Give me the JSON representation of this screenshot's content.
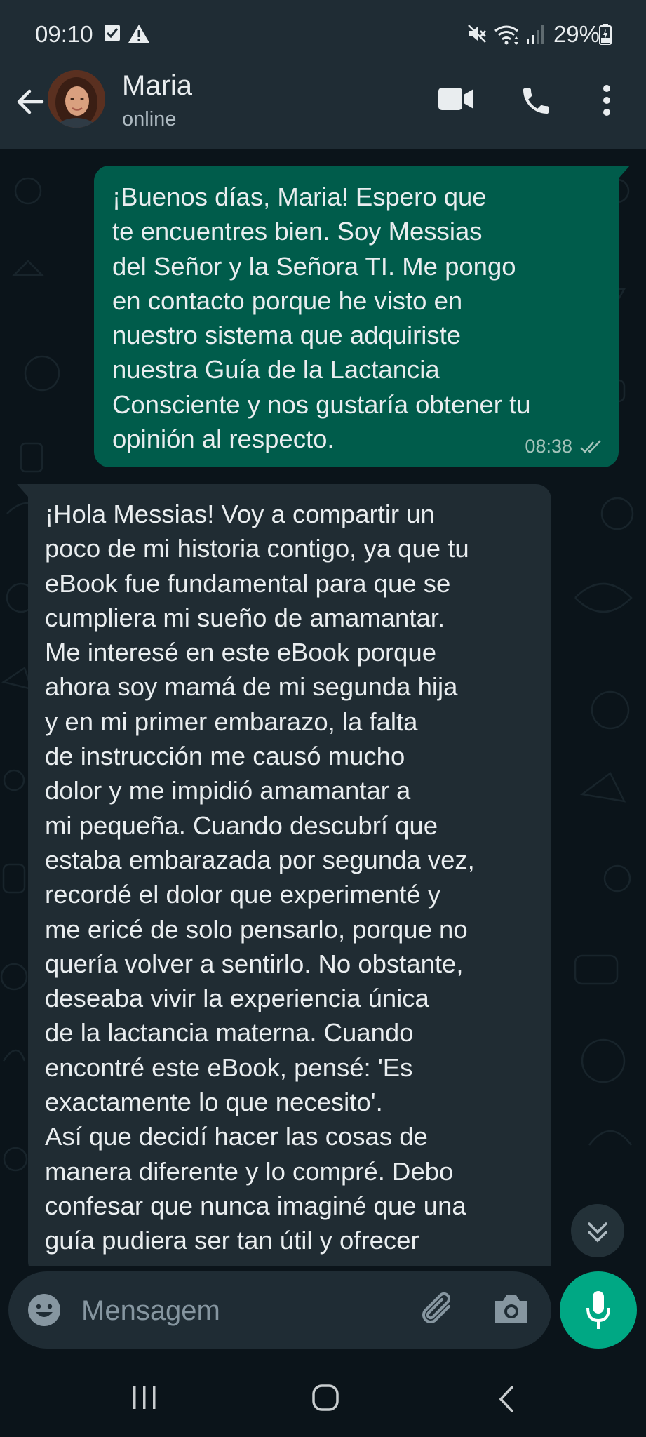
{
  "status_bar": {
    "time": "09:10",
    "battery": "29%"
  },
  "contact": {
    "name": "Maria",
    "presence": "online"
  },
  "messages": {
    "outgoing": {
      "text": "¡Buenos días, Maria! Espero que\nte encuentres bien. Soy Messias\ndel Señor y la Señora TI. Me pongo\nen contacto porque he visto en\nnuestro sistema que adquiriste\nnuestra Guía de la Lactancia\nConsciente y nos gustaría obtener tu\nopinión al respecto.",
      "time": "08:38"
    },
    "incoming": {
      "text": "¡Hola Messias! Voy a compartir un\npoco de mi historia contigo, ya que tu\neBook fue fundamental para que se\ncumpliera mi sueño de amamantar.\nMe interesé en este eBook porque\nahora soy mamá de mi segunda hija\ny en mi primer embarazo, la falta\nde instrucción me causó mucho\ndolor y me impidió amamantar a\nmi pequeña. Cuando descubrí que\nestaba embarazada por segunda vez,\nrecordé el dolor que experimenté y\nme ericé de solo pensarlo, porque no\nquería volver a sentirlo. No obstante,\ndeseaba vivir la experiencia única\nde la lactancia materna. Cuando\nencontré este eBook, pensé: 'Es\nexactamente lo que necesito'.\nAsí que decidí hacer las cosas de\nmanera diferente y lo compré. Debo\nconfesar que nunca imaginé que una\nguía pudiera ser tan útil y ofrecer"
    }
  },
  "composer": {
    "placeholder": "Mensagem"
  },
  "colors": {
    "outgoing_bubble": "#005c4b",
    "incoming_bubble": "#202c33",
    "accent": "#00a884",
    "header": "#1f2c34",
    "background": "#0b141a"
  }
}
